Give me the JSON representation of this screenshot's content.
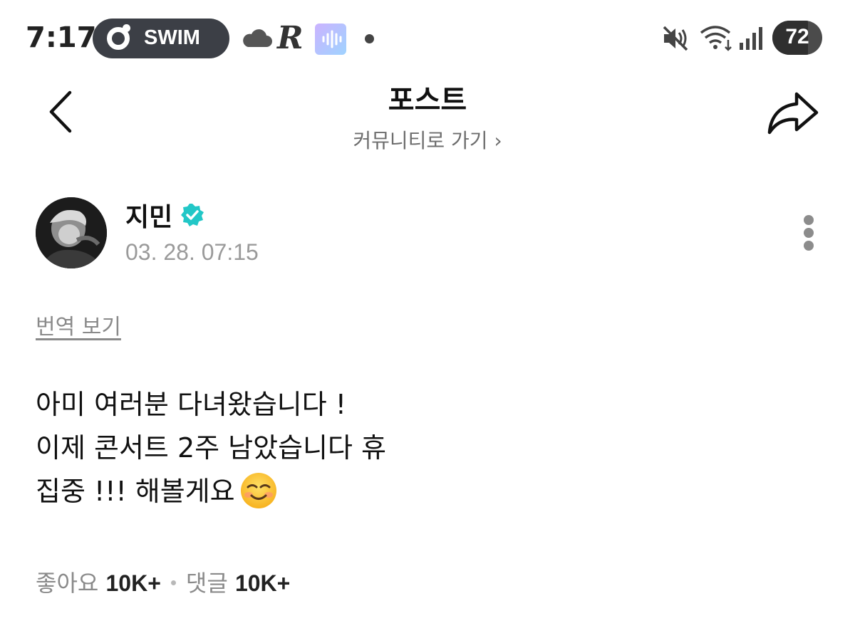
{
  "status_bar": {
    "time": "7:17",
    "app_pill_label": "SWIM",
    "notification_icons": [
      "cloud-icon",
      "r-app-icon",
      "audio-wave-icon",
      "dot-icon"
    ],
    "system_icons": [
      "mute-icon",
      "wifi-icon",
      "signal-icon"
    ],
    "battery_level": "72",
    "battery_fraction": 0.72
  },
  "header": {
    "title": "포스트",
    "community_link": "커뮤니티로 가기 ›"
  },
  "post": {
    "author_name": "지민",
    "verified": true,
    "date": "03. 28. 07:15",
    "translate_label": "번역 보기",
    "lines": [
      "아미 여러분 다녀왔습니다 !",
      "이제 콘서트 2주 남았습니다 휴",
      "집중 !!! 해볼게요"
    ],
    "emoji": "smiling-face-emoji"
  },
  "stats": {
    "likes_label": "좋아요",
    "likes_count": "10K+",
    "comments_label": "댓글",
    "comments_count": "10K+"
  },
  "colors": {
    "verified": "#22c7c7",
    "pill_bg": "#3c3f46",
    "muted_text": "#8a8a8a"
  }
}
